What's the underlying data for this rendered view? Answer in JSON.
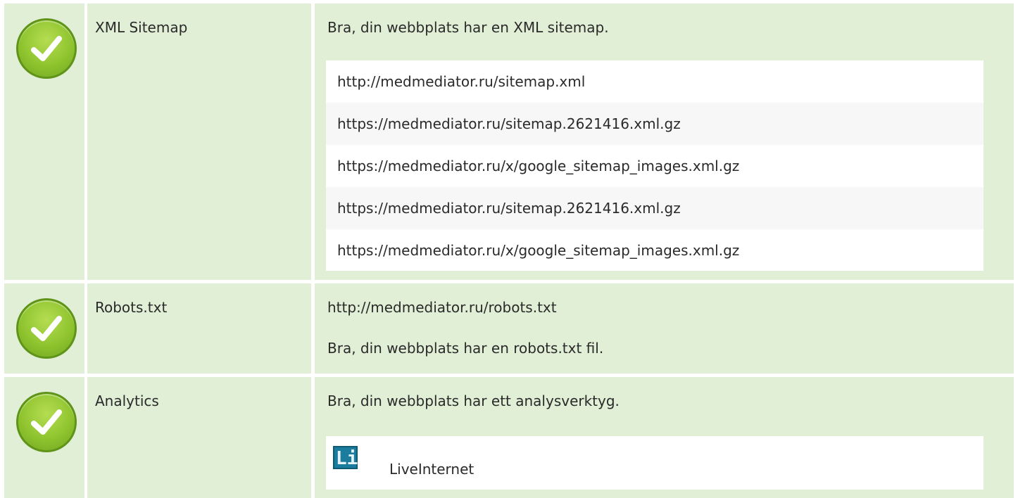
{
  "rows": {
    "sitemap": {
      "status": "pass",
      "name": "XML Sitemap",
      "message": "Bra, din webbplats har en XML sitemap.",
      "urls": [
        "http://medmediator.ru/sitemap.xml",
        "https://medmediator.ru/sitemap.2621416.xml.gz",
        "https://medmediator.ru/x/google_sitemap_images.xml.gz",
        "https://medmediator.ru/sitemap.2621416.xml.gz",
        "https://medmediator.ru/x/google_sitemap_images.xml.gz"
      ]
    },
    "robots": {
      "status": "pass",
      "name": "Robots.txt",
      "url": "http://medmediator.ru/robots.txt",
      "message": "Bra, din webbplats har en robots.txt fil."
    },
    "analytics": {
      "status": "pass",
      "name": "Analytics",
      "message": "Bra, din webbplats har ett analysverktyg.",
      "tools": [
        {
          "icon": "liveinternet-logo-icon",
          "logo_text": "Li",
          "label": "LiveInternet"
        }
      ]
    }
  },
  "colors": {
    "row_bg": "#e0efd6",
    "check_green": "#8fc42f",
    "liveinternet_blue": "#1a7d9e"
  }
}
